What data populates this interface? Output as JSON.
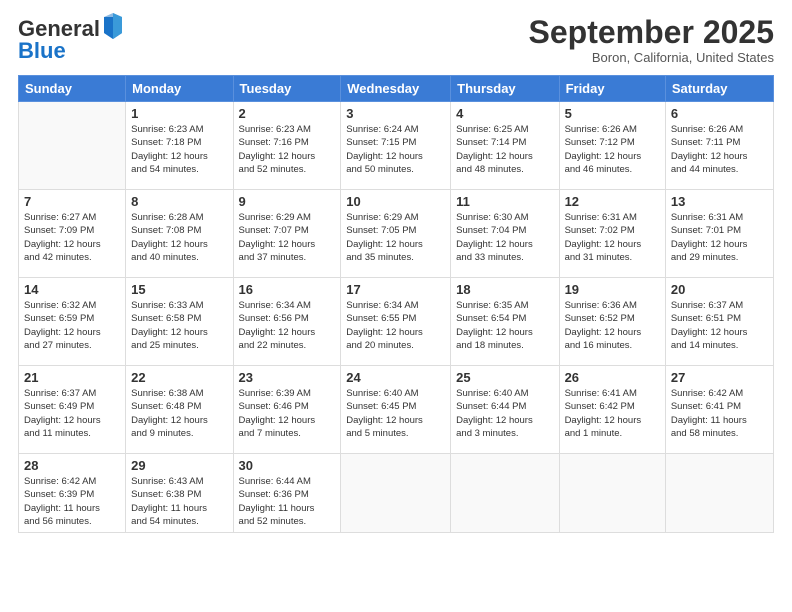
{
  "header": {
    "logo_general": "General",
    "logo_blue": "Blue",
    "month_title": "September 2025",
    "subtitle": "Boron, California, United States"
  },
  "days_of_week": [
    "Sunday",
    "Monday",
    "Tuesday",
    "Wednesday",
    "Thursday",
    "Friday",
    "Saturday"
  ],
  "weeks": [
    [
      {
        "day": "",
        "content": ""
      },
      {
        "day": "1",
        "content": "Sunrise: 6:23 AM\nSunset: 7:18 PM\nDaylight: 12 hours\nand 54 minutes."
      },
      {
        "day": "2",
        "content": "Sunrise: 6:23 AM\nSunset: 7:16 PM\nDaylight: 12 hours\nand 52 minutes."
      },
      {
        "day": "3",
        "content": "Sunrise: 6:24 AM\nSunset: 7:15 PM\nDaylight: 12 hours\nand 50 minutes."
      },
      {
        "day": "4",
        "content": "Sunrise: 6:25 AM\nSunset: 7:14 PM\nDaylight: 12 hours\nand 48 minutes."
      },
      {
        "day": "5",
        "content": "Sunrise: 6:26 AM\nSunset: 7:12 PM\nDaylight: 12 hours\nand 46 minutes."
      },
      {
        "day": "6",
        "content": "Sunrise: 6:26 AM\nSunset: 7:11 PM\nDaylight: 12 hours\nand 44 minutes."
      }
    ],
    [
      {
        "day": "7",
        "content": "Sunrise: 6:27 AM\nSunset: 7:09 PM\nDaylight: 12 hours\nand 42 minutes."
      },
      {
        "day": "8",
        "content": "Sunrise: 6:28 AM\nSunset: 7:08 PM\nDaylight: 12 hours\nand 40 minutes."
      },
      {
        "day": "9",
        "content": "Sunrise: 6:29 AM\nSunset: 7:07 PM\nDaylight: 12 hours\nand 37 minutes."
      },
      {
        "day": "10",
        "content": "Sunrise: 6:29 AM\nSunset: 7:05 PM\nDaylight: 12 hours\nand 35 minutes."
      },
      {
        "day": "11",
        "content": "Sunrise: 6:30 AM\nSunset: 7:04 PM\nDaylight: 12 hours\nand 33 minutes."
      },
      {
        "day": "12",
        "content": "Sunrise: 6:31 AM\nSunset: 7:02 PM\nDaylight: 12 hours\nand 31 minutes."
      },
      {
        "day": "13",
        "content": "Sunrise: 6:31 AM\nSunset: 7:01 PM\nDaylight: 12 hours\nand 29 minutes."
      }
    ],
    [
      {
        "day": "14",
        "content": "Sunrise: 6:32 AM\nSunset: 6:59 PM\nDaylight: 12 hours\nand 27 minutes."
      },
      {
        "day": "15",
        "content": "Sunrise: 6:33 AM\nSunset: 6:58 PM\nDaylight: 12 hours\nand 25 minutes."
      },
      {
        "day": "16",
        "content": "Sunrise: 6:34 AM\nSunset: 6:56 PM\nDaylight: 12 hours\nand 22 minutes."
      },
      {
        "day": "17",
        "content": "Sunrise: 6:34 AM\nSunset: 6:55 PM\nDaylight: 12 hours\nand 20 minutes."
      },
      {
        "day": "18",
        "content": "Sunrise: 6:35 AM\nSunset: 6:54 PM\nDaylight: 12 hours\nand 18 minutes."
      },
      {
        "day": "19",
        "content": "Sunrise: 6:36 AM\nSunset: 6:52 PM\nDaylight: 12 hours\nand 16 minutes."
      },
      {
        "day": "20",
        "content": "Sunrise: 6:37 AM\nSunset: 6:51 PM\nDaylight: 12 hours\nand 14 minutes."
      }
    ],
    [
      {
        "day": "21",
        "content": "Sunrise: 6:37 AM\nSunset: 6:49 PM\nDaylight: 12 hours\nand 11 minutes."
      },
      {
        "day": "22",
        "content": "Sunrise: 6:38 AM\nSunset: 6:48 PM\nDaylight: 12 hours\nand 9 minutes."
      },
      {
        "day": "23",
        "content": "Sunrise: 6:39 AM\nSunset: 6:46 PM\nDaylight: 12 hours\nand 7 minutes."
      },
      {
        "day": "24",
        "content": "Sunrise: 6:40 AM\nSunset: 6:45 PM\nDaylight: 12 hours\nand 5 minutes."
      },
      {
        "day": "25",
        "content": "Sunrise: 6:40 AM\nSunset: 6:44 PM\nDaylight: 12 hours\nand 3 minutes."
      },
      {
        "day": "26",
        "content": "Sunrise: 6:41 AM\nSunset: 6:42 PM\nDaylight: 12 hours\nand 1 minute."
      },
      {
        "day": "27",
        "content": "Sunrise: 6:42 AM\nSunset: 6:41 PM\nDaylight: 11 hours\nand 58 minutes."
      }
    ],
    [
      {
        "day": "28",
        "content": "Sunrise: 6:42 AM\nSunset: 6:39 PM\nDaylight: 11 hours\nand 56 minutes."
      },
      {
        "day": "29",
        "content": "Sunrise: 6:43 AM\nSunset: 6:38 PM\nDaylight: 11 hours\nand 54 minutes."
      },
      {
        "day": "30",
        "content": "Sunrise: 6:44 AM\nSunset: 6:36 PM\nDaylight: 11 hours\nand 52 minutes."
      },
      {
        "day": "",
        "content": ""
      },
      {
        "day": "",
        "content": ""
      },
      {
        "day": "",
        "content": ""
      },
      {
        "day": "",
        "content": ""
      }
    ]
  ]
}
